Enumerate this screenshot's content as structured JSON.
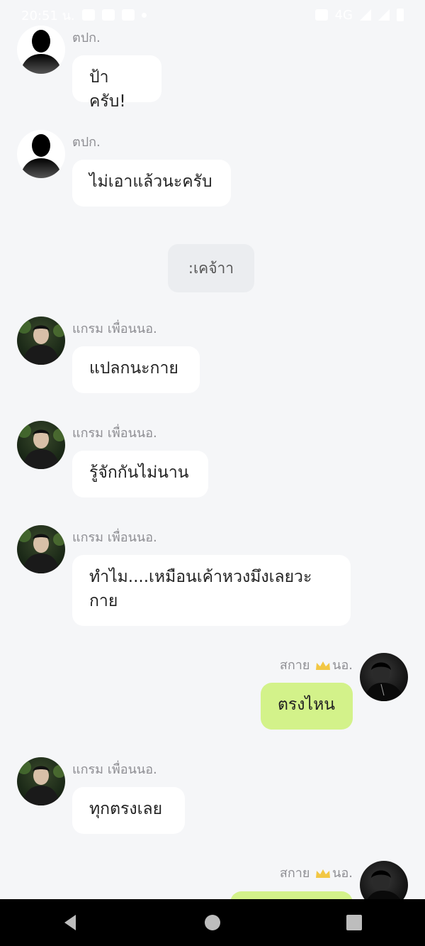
{
  "status_bar": {
    "time": "20:51 น.",
    "network": "4G"
  },
  "contacts": {
    "tapak": "ตปก.",
    "gram": "แกรม เพื่อนนอ.",
    "skai_prefix": "สกาย",
    "skai_suffix": "นอ."
  },
  "messages": [
    {
      "text": "ป้าครับ!"
    },
    {
      "text": "ไม่เอาแล้วนะครับ"
    },
    {
      "text": ":เคจ้าา"
    },
    {
      "text": "แปลกนะกาย"
    },
    {
      "text": "รู้จักกันไม่นาน"
    },
    {
      "text": "ทำไม....เหมือนเค้าหวงมึงเลยวะกาย"
    },
    {
      "text": "ตรงไหน"
    },
    {
      "text": "ทุกตรงเลย"
    }
  ],
  "colors": {
    "background": "#f5f6f8",
    "incoming_bubble": "#ffffff",
    "outgoing_bubble": "#d3f28a",
    "sender_text": "#8e8e93"
  },
  "icons": {
    "back": "back-triangle-icon",
    "home": "home-circle-icon",
    "recents": "recents-square-icon",
    "crown": "crown-icon"
  }
}
